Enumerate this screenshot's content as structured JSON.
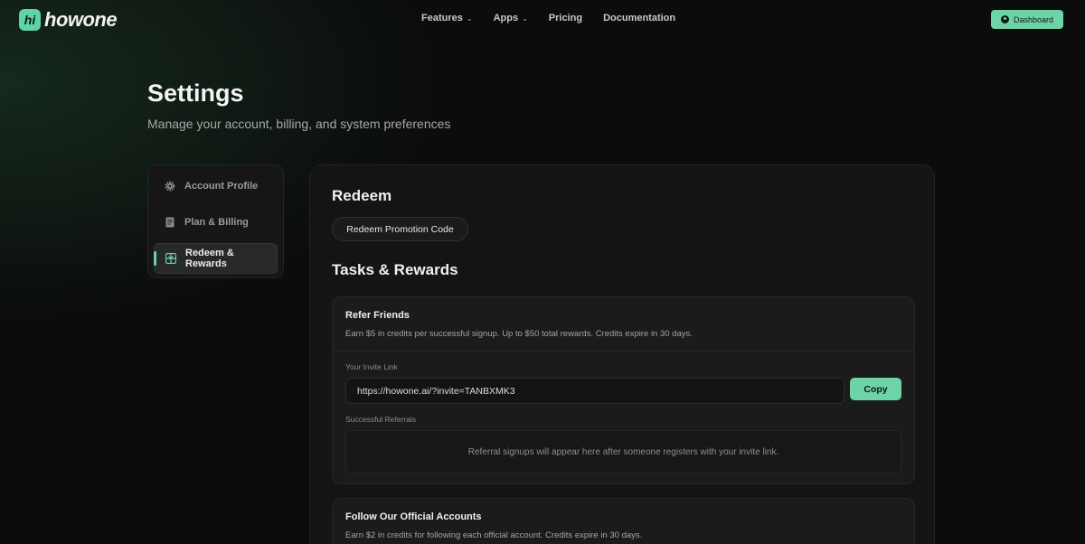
{
  "brand": {
    "logo_mark": "hi",
    "name": "howone",
    "accent": "#6fd3a8"
  },
  "nav": {
    "links": [
      {
        "label": "Features",
        "has_dropdown": true
      },
      {
        "label": "Apps",
        "has_dropdown": true
      },
      {
        "label": "Pricing",
        "has_dropdown": false
      },
      {
        "label": "Documentation",
        "has_dropdown": false
      }
    ],
    "dashboard_label": "Dashboard"
  },
  "header": {
    "title": "Settings",
    "subtitle": "Manage your account, billing, and system preferences"
  },
  "sidebar": {
    "items": [
      {
        "label": "Account Profile",
        "icon": "gear-icon",
        "active": false
      },
      {
        "label": "Plan & Billing",
        "icon": "document-icon",
        "active": false
      },
      {
        "label": "Redeem & Rewards",
        "icon": "gift-icon",
        "active": true
      }
    ]
  },
  "main": {
    "redeem_heading": "Redeem",
    "promo_button": "Redeem Promotion Code",
    "tasks_heading": "Tasks & Rewards",
    "refer": {
      "title": "Refer Friends",
      "description": "Earn $5 in credits per successful signup. Up to $50 total rewards. Credits expire in 30 days.",
      "invite_label": "Your Invite Link",
      "invite_link": "https://howone.ai/?invite=TANBXMK3",
      "copy_label": "Copy",
      "referrals_label": "Successful Referrals",
      "referrals_empty": "Referral signups will appear here after someone registers with your invite link."
    },
    "follow": {
      "title": "Follow Our Official Accounts",
      "description": "Earn $2 in credits for following each official account. Credits expire in 30 days."
    }
  }
}
